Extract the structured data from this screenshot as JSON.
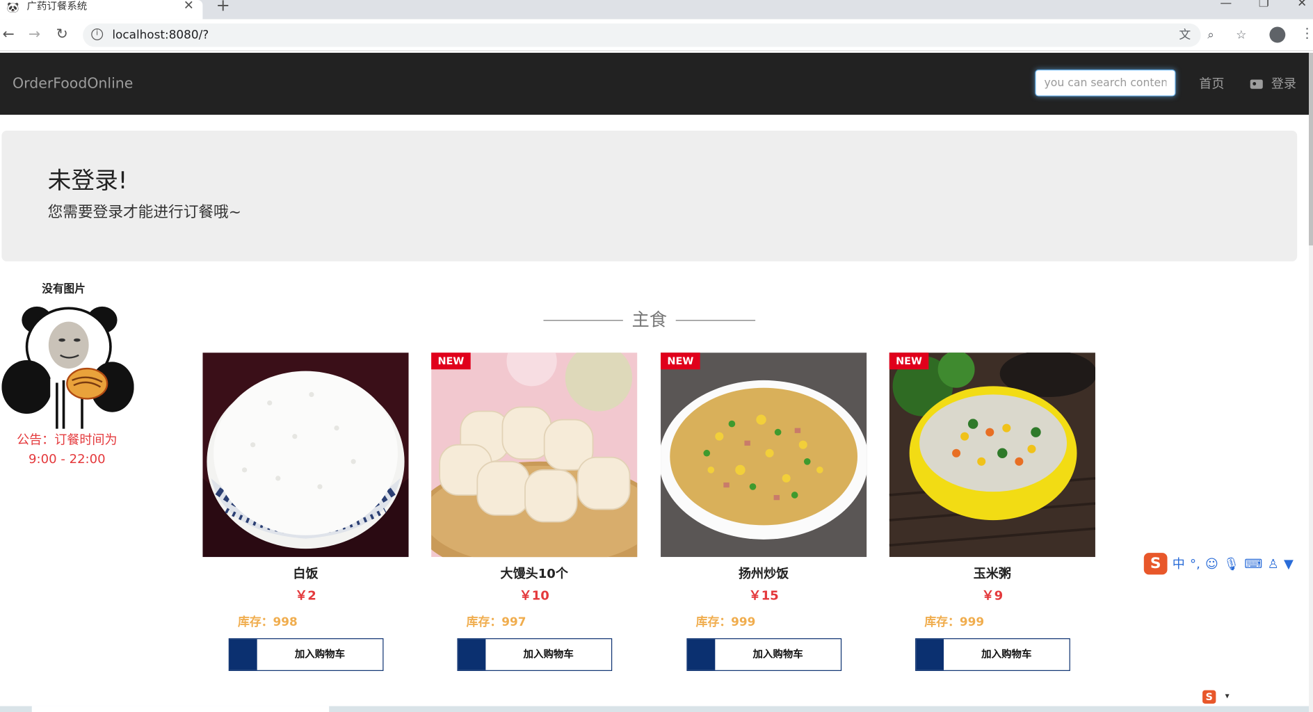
{
  "browser": {
    "tab_title": "广药订餐系统",
    "tab_favicon": "panda-favicon",
    "url": "localhost:8080/?"
  },
  "navbar": {
    "brand": "OrderFoodOnline",
    "search_placeholder": "you can search content",
    "home_link": "首页",
    "login_link": "登录"
  },
  "jumbotron": {
    "title": "未登录!",
    "subtitle": "您需要登录才能进行订餐哦~"
  },
  "sidebar": {
    "no_image_label": "没有图片",
    "notice_line1": "公告：订餐时间为",
    "notice_line2": "9:00 - 22:00"
  },
  "section": {
    "title": "主食"
  },
  "products": [
    {
      "name": "白饭",
      "price": "￥2",
      "stock": "库存：998",
      "badge": "",
      "cart_label": "加入购物车",
      "image": "white-rice-bowl"
    },
    {
      "name": "大馒头10个",
      "price": "￥10",
      "stock": "库存：997",
      "badge": "NEW",
      "cart_label": "加入购物车",
      "image": "steamed-buns"
    },
    {
      "name": "扬州炒饭",
      "price": "￥15",
      "stock": "库存：999",
      "badge": "NEW",
      "cart_label": "加入购物车",
      "image": "fried-rice-plate"
    },
    {
      "name": "玉米粥",
      "price": "￥9",
      "stock": "库存：999",
      "badge": "NEW",
      "cart_label": "加入购物车",
      "image": "corn-porridge-bowl"
    }
  ],
  "ime": {
    "lang": "中",
    "punct": "°,"
  },
  "colors": {
    "navbar_bg": "#222222",
    "price": "#e4393c",
    "stock": "#f0ad4e",
    "cart_accent": "#0b3070",
    "badge": "#e0001b"
  }
}
